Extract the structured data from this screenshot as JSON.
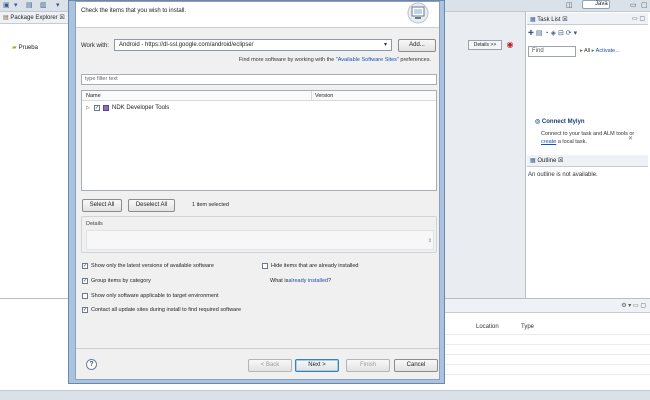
{
  "eclipse": {
    "perspective_label": "Java",
    "package_explorer": {
      "tab_label": "Package Explorer",
      "items": [
        "Prueba"
      ]
    },
    "details_button": "Details >>",
    "task_list": {
      "tab_label": "Task List",
      "find_placeholder": "Find",
      "all_label": "All",
      "activate_link": "Activate..."
    },
    "mylyn": {
      "title": "Connect Mylyn",
      "text_pre": "Connect to your task and ALM tools or ",
      "create_link": "create",
      "text_post": " a local task."
    },
    "outline": {
      "tab_label": "Outline",
      "message": "An outline is not available."
    },
    "bottom_columns": [
      "Location",
      "Type"
    ]
  },
  "dialog": {
    "description": "Check the items that you wish to install.",
    "work_with_label": "Work with:",
    "work_with_value": "Android - https://dl-ssl.google.com/android/eclipse/",
    "add_button": "Add...",
    "more_software_pre": "Find more software by working with the ",
    "more_software_link": "\"Available Software Sites\"",
    "more_software_post": " preferences.",
    "filter_placeholder": "type filter text",
    "tree": {
      "columns": [
        "Name",
        "Version"
      ],
      "rows": [
        {
          "label": "NDK Developer Tools",
          "checked": true
        }
      ]
    },
    "select_all_button": "Select All",
    "deselect_all_button": "Deselect All",
    "items_selected": "1 item selected",
    "details_label": "Details",
    "options": {
      "show_latest": {
        "label": "Show only the latest versions of available software",
        "checked": true
      },
      "hide_installed": {
        "label": "Hide items that are already installed",
        "checked": false
      },
      "group_category": {
        "label": "Group items by category",
        "checked": true
      },
      "already_installed_pre": "What is ",
      "already_installed_link": "already installed",
      "already_installed_post": "?",
      "show_applicable": {
        "label": "Show only software applicable to target environment",
        "checked": false
      },
      "contact_sites": {
        "label": "Contact all update sites during install to find required software",
        "checked": true
      }
    },
    "buttons": {
      "back": "< Back",
      "next": "Next >",
      "finish": "Finish",
      "cancel": "Cancel"
    },
    "help_symbol": "?"
  }
}
